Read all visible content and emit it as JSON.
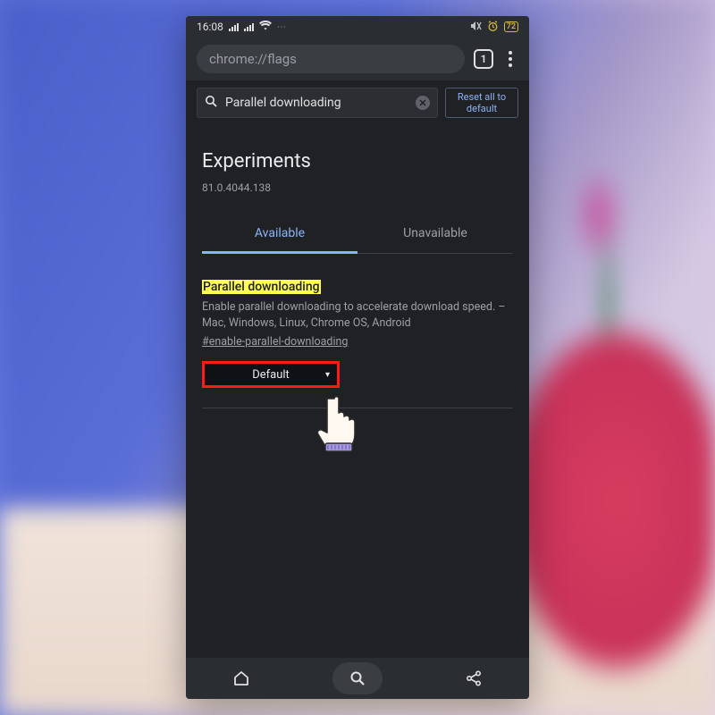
{
  "status": {
    "time": "16:08",
    "battery": "72"
  },
  "browser": {
    "url": "chrome://flags",
    "tab_count": "1"
  },
  "search": {
    "query": "Parallel downloading",
    "reset_label": "Reset all to default"
  },
  "page": {
    "title": "Experiments",
    "version": "81.0.4044.138"
  },
  "tabs": {
    "available": "Available",
    "unavailable": "Unavailable"
  },
  "flag": {
    "title": "Parallel downloading",
    "description": "Enable parallel downloading to accelerate download speed. – Mac, Windows, Linux, Chrome OS, Android",
    "anchor": "#enable-parallel-downloading",
    "value": "Default"
  }
}
